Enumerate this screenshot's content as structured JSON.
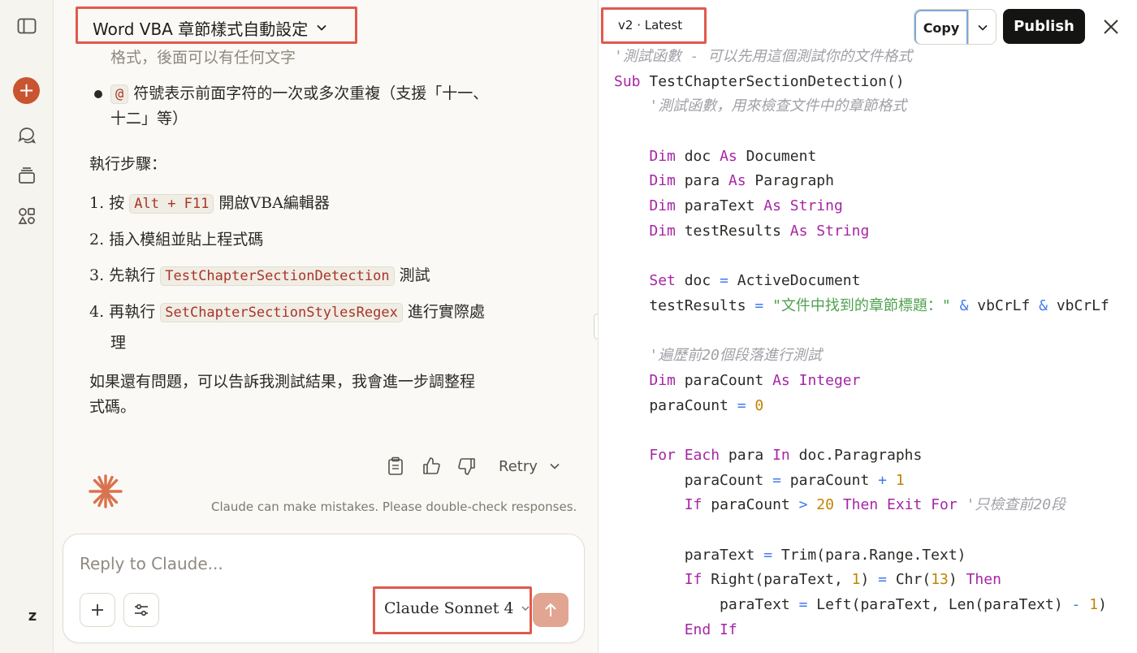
{
  "chat": {
    "title": "Word VBA 章節樣式自動設定",
    "top_fragment": "格式，後面可以有任何文字",
    "bullet": {
      "code": "@",
      "text_line1": "符號表示前面字符的一次或多次重複（支援「十一、",
      "text_line2": "十二」等）"
    },
    "steps_heading": "執行步驟：",
    "steps": [
      {
        "num": "1.",
        "before": "按",
        "code": "Alt + F11",
        "after": "開啟VBA編輯器"
      },
      {
        "num": "2.",
        "before": "插入模組並貼上程式碼",
        "code": "",
        "after": ""
      },
      {
        "num": "3.",
        "before": "先執行",
        "code": "TestChapterSectionDetection",
        "after": "測試"
      },
      {
        "num": "4.",
        "before": "再執行",
        "code": "SetChapterSectionStylesRegex",
        "after": "進行實際處",
        "after_line2": "理"
      }
    ],
    "closing_line1": "如果還有問題，可以告訴我測試結果，我會進一步調整程",
    "closing_line2": "式碼。",
    "retry_label": "Retry",
    "disclaimer": "Claude can make mistakes. Please double-check responses.",
    "composer": {
      "placeholder": "Reply to Claude...",
      "model_name": "Claude Sonnet 4"
    }
  },
  "artifact": {
    "version_label": "v2 · Latest",
    "copy_label": "Copy",
    "publish_label": "Publish",
    "code_lines": [
      [
        [
          "c",
          "'測試函數 - 可以先用這個測試你的文件格式"
        ]
      ],
      [
        [
          "k",
          "Sub"
        ],
        [
          "p",
          " TestChapterSectionDetection()"
        ]
      ],
      [
        [
          "p",
          "    "
        ],
        [
          "c",
          "'測試函數，用來檢查文件中的章節格式"
        ]
      ],
      [
        [
          "p",
          ""
        ]
      ],
      [
        [
          "p",
          "    "
        ],
        [
          "k",
          "Dim"
        ],
        [
          "p",
          " doc "
        ],
        [
          "k",
          "As"
        ],
        [
          "p",
          " Document"
        ]
      ],
      [
        [
          "p",
          "    "
        ],
        [
          "k",
          "Dim"
        ],
        [
          "p",
          " para "
        ],
        [
          "k",
          "As"
        ],
        [
          "p",
          " Paragraph"
        ]
      ],
      [
        [
          "p",
          "    "
        ],
        [
          "k",
          "Dim"
        ],
        [
          "p",
          " paraText "
        ],
        [
          "k",
          "As"
        ],
        [
          "p",
          " "
        ],
        [
          "t",
          "String"
        ]
      ],
      [
        [
          "p",
          "    "
        ],
        [
          "k",
          "Dim"
        ],
        [
          "p",
          " testResults "
        ],
        [
          "k",
          "As"
        ],
        [
          "p",
          " "
        ],
        [
          "t",
          "String"
        ]
      ],
      [
        [
          "p",
          ""
        ]
      ],
      [
        [
          "p",
          "    "
        ],
        [
          "k",
          "Set"
        ],
        [
          "p",
          " doc "
        ],
        [
          "o",
          "="
        ],
        [
          "p",
          " ActiveDocument"
        ]
      ],
      [
        [
          "p",
          "    testResults "
        ],
        [
          "o",
          "="
        ],
        [
          "p",
          " "
        ],
        [
          "s",
          "\"文件中找到的章節標題：\""
        ],
        [
          "p",
          " "
        ],
        [
          "o",
          "&"
        ],
        [
          "p",
          " vbCrLf "
        ],
        [
          "o",
          "&"
        ],
        [
          "p",
          " vbCrLf"
        ]
      ],
      [
        [
          "p",
          ""
        ]
      ],
      [
        [
          "p",
          "    "
        ],
        [
          "c",
          "'遍歷前20個段落進行測試"
        ]
      ],
      [
        [
          "p",
          "    "
        ],
        [
          "k",
          "Dim"
        ],
        [
          "p",
          " paraCount "
        ],
        [
          "k",
          "As"
        ],
        [
          "p",
          " "
        ],
        [
          "t",
          "Integer"
        ]
      ],
      [
        [
          "p",
          "    paraCount "
        ],
        [
          "o",
          "="
        ],
        [
          "p",
          " "
        ],
        [
          "n",
          "0"
        ]
      ],
      [
        [
          "p",
          ""
        ]
      ],
      [
        [
          "p",
          "    "
        ],
        [
          "k",
          "For Each"
        ],
        [
          "p",
          " para "
        ],
        [
          "k",
          "In"
        ],
        [
          "p",
          " doc.Paragraphs"
        ]
      ],
      [
        [
          "p",
          "        paraCount "
        ],
        [
          "o",
          "="
        ],
        [
          "p",
          " paraCount "
        ],
        [
          "o",
          "+"
        ],
        [
          "p",
          " "
        ],
        [
          "n",
          "1"
        ]
      ],
      [
        [
          "p",
          "        "
        ],
        [
          "k",
          "If"
        ],
        [
          "p",
          " paraCount "
        ],
        [
          "o",
          ">"
        ],
        [
          "p",
          " "
        ],
        [
          "n",
          "20"
        ],
        [
          "p",
          " "
        ],
        [
          "k",
          "Then Exit For"
        ],
        [
          "p",
          " "
        ],
        [
          "c",
          "'只檢查前20段"
        ]
      ],
      [
        [
          "p",
          ""
        ]
      ],
      [
        [
          "p",
          "        paraText "
        ],
        [
          "o",
          "="
        ],
        [
          "p",
          " Trim(para.Range.Text)"
        ]
      ],
      [
        [
          "p",
          "        "
        ],
        [
          "k",
          "If"
        ],
        [
          "p",
          " Right(paraText, "
        ],
        [
          "n",
          "1"
        ],
        [
          "p",
          ") "
        ],
        [
          "o",
          "="
        ],
        [
          "p",
          " Chr("
        ],
        [
          "n",
          "13"
        ],
        [
          "p",
          ") "
        ],
        [
          "k",
          "Then"
        ]
      ],
      [
        [
          "p",
          "            paraText "
        ],
        [
          "o",
          "="
        ],
        [
          "p",
          " Left(paraText, Len(paraText) "
        ],
        [
          "o",
          "-"
        ],
        [
          "p",
          " "
        ],
        [
          "n",
          "1"
        ],
        [
          "p",
          ")"
        ]
      ],
      [
        [
          "p",
          "        "
        ],
        [
          "k",
          "End If"
        ]
      ]
    ]
  },
  "icons": {
    "sidebar_toggle": "sidebar-toggle-icon",
    "new_chat": "plus-icon",
    "chats": "chat-bubbles-icon",
    "projects": "stack-icon",
    "artifacts": "shapes-icon"
  },
  "colors": {
    "accent": "#c8552f",
    "highlight_box": "#e05a4c",
    "publish_bg": "#141413",
    "send_bg": "#e1a592"
  }
}
